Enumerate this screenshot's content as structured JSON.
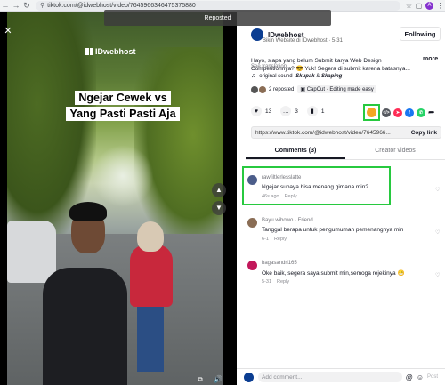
{
  "browser": {
    "url": "tiktok.com/@idwebhost/video/7645966346475375880",
    "profile_initial": "A"
  },
  "video": {
    "repost_label": "Reposted",
    "brand": "IDwebhost",
    "caption_line1": "Ngejar Cewek vs",
    "caption_line2": "Yang Pasti Pasti Aja"
  },
  "author": {
    "name": "IDwebhost",
    "subtitle": "Bikin Website di IDwebhost · 5-31",
    "follow_label": "Following"
  },
  "description": {
    "text": "Hayo, siapa yang belum Submit karya Web Design Competitionnya? 😎 Yuk! Segera di submit karena batasnya...",
    "more_label": "more",
    "see_translation": "See translation"
  },
  "sound": {
    "prefix": "original sound - ",
    "artist1": "Skupak",
    "joiner": " & ",
    "artist2": "Skaping"
  },
  "repost_info": {
    "text": "2 reposted",
    "capcut": "CapCut · Editing made easy"
  },
  "actions": {
    "likes": "13",
    "comments": "3",
    "saves": "1"
  },
  "share": {
    "link": "https://www.tiktok.com/@idwebhost/video/7645966...",
    "copy_label": "Copy link"
  },
  "tabs": [
    {
      "label": "Comments (3)"
    },
    {
      "label": "Creator videos"
    }
  ],
  "comments": [
    {
      "user": "rawfiltlerlesslatte",
      "text": "Ngejar supaya bisa menang gimana min?",
      "time": "46s ago",
      "reply": "Reply",
      "likes": "0",
      "color": "#4b5d8a"
    },
    {
      "user": "Bayu wibowo · Friend",
      "text": "Tanggal berapa untuk pengumuman pemenangnya min",
      "time": "6-1",
      "reply": "Reply",
      "likes": "0",
      "color": "#8a6d55"
    },
    {
      "user": "bagasandri165",
      "text": "Oke baik, segera saya submit min,semoga rejekinya 😁",
      "time": "5-31",
      "reply": "Reply",
      "likes": "0",
      "color": "#c2185b"
    }
  ],
  "comment_bar": {
    "placeholder": "Add comment...",
    "post_label": "Post"
  }
}
